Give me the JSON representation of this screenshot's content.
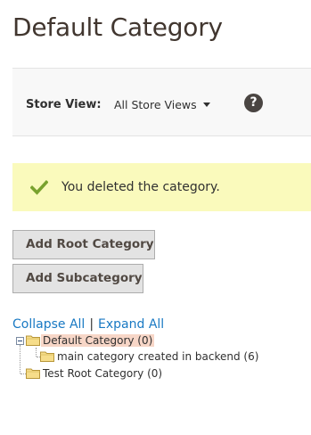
{
  "page": {
    "title": "Default Category"
  },
  "store_view": {
    "label": "Store View:",
    "selected": "All Store Views",
    "help_icon": "question-mark-icon"
  },
  "message": {
    "text": "You deleted the category.",
    "type": "success",
    "icon": "checkmark-icon"
  },
  "buttons": {
    "add_root": "Add Root Category",
    "add_sub": "Add Subcategory"
  },
  "tree_actions": {
    "collapse_all": "Collapse All",
    "separator": "|",
    "expand_all": "Expand All"
  },
  "tree": {
    "nodes": [
      {
        "label": "Default Category (0)",
        "selected": true,
        "expanded": true,
        "icon": "folder-icon"
      },
      {
        "label": "main category created in backend (6)",
        "selected": false,
        "icon": "folder-icon"
      },
      {
        "label": "Test Root Category (0)",
        "selected": false,
        "icon": "folder-icon"
      }
    ]
  },
  "colors": {
    "link": "#1979c3",
    "success_bg": "#fafabc",
    "success_icon": "#79a22e",
    "selected_node_bg": "#f7d6c7",
    "button_bg": "#e3e3e3"
  }
}
